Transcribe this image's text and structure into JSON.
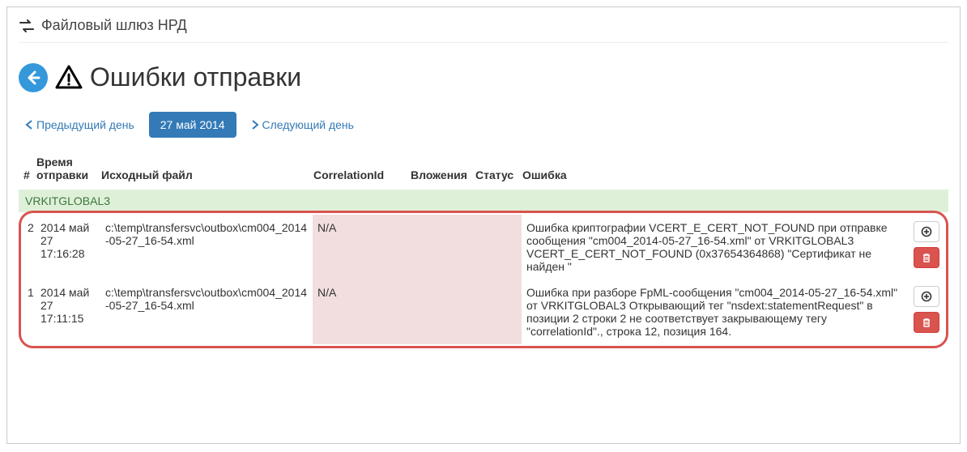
{
  "app_title": "Файловый шлюз НРД",
  "page_title": "Ошибки отправки",
  "nav": {
    "prev": "Предыдущий день",
    "date": "27 май 2014",
    "next": "Следующий день"
  },
  "columns": {
    "num": "#",
    "time": "Время отправки",
    "file": "Исходный файл",
    "corr": "CorrelationId",
    "att": "Вложения",
    "status": "Статус",
    "err": "Ошибка"
  },
  "group": "VRKITGLOBAL3",
  "rows": [
    {
      "num": "2",
      "time": "2014 май 27 17:16:28",
      "file": "c:\\temp\\transfersvc\\outbox\\cm004_2014-05-27_16-54.xml",
      "corr": "N/A",
      "att": "",
      "status": "",
      "err": "Ошибка криптографии VCERT_E_CERT_NOT_FOUND при отправке сообщения \"cm004_2014-05-27_16-54.xml\" от VRKITGLOBAL3 VCERT_E_CERT_NOT_FOUND (0x37654364868) \"Сертификат не найден \""
    },
    {
      "num": "1",
      "time": "2014 май 27 17:11:15",
      "file": "c:\\temp\\transfersvc\\outbox\\cm004_2014-05-27_16-54.xml",
      "corr": "N/A",
      "att": "",
      "status": "",
      "err": "Ошибка при разборе FpML-сообщения \"cm004_2014-05-27_16-54.xml\" от VRKITGLOBAL3 Открывающий тег \"nsdext:statementRequest\" в позиции 2 строки 2 не соответствует закрывающему тегу \"correlationId\"., строка 12, позиция 164."
    }
  ]
}
